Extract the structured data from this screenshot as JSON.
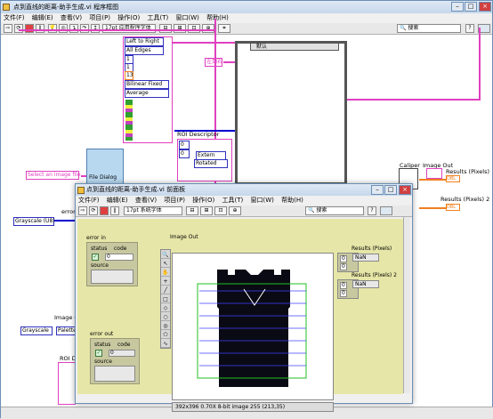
{
  "block_diagram": {
    "title": "点到直线的距离-助手生成.vi 程序框图",
    "menu": [
      "文件(F)",
      "编辑(E)",
      "查看(V)",
      "项目(P)",
      "操作(O)",
      "工具(T)",
      "窗口(W)",
      "帮助(H)"
    ],
    "font_selector": "17pt 应用程序字体",
    "search_placeholder": "搜索",
    "direction_value": "Left to Right",
    "edge_value": "All Edges",
    "num_values": [
      "1",
      "1",
      "13"
    ],
    "interp_value": "Bilinear Fixed",
    "avg_value": "Average",
    "case_label": "默认",
    "left_to_right_const": "左到右",
    "roi_descriptor_label": "ROI Descriptor",
    "roi_values": [
      "0",
      "0"
    ],
    "extern_value": "Extern",
    "rotated_value": "Rotated",
    "file_dialog_label": "File Dialog",
    "select_image_prompt": "Select an image file...",
    "grayscale_u8": "Grayscale (U8)",
    "error_label": "error",
    "image_label": "Image O",
    "grayscale": "Grayscale",
    "palette": "Palette",
    "roi_label": "ROI D",
    "caliper_label": "Caliper",
    "image_out_label": "Image Out",
    "results_label": "Results (Pixels)",
    "results2_label": "Results (Pixels) 2",
    "dbl_tag": "DBL"
  },
  "front_panel": {
    "title": "点到直线的距离-助手生成.vi 前面板",
    "menu": [
      "文件(F)",
      "编辑(E)",
      "查看(V)",
      "项目(P)",
      "操作(O)",
      "工具(T)",
      "窗口(W)",
      "帮助(H)"
    ],
    "font_selector": "17pt 系统字体",
    "search_placeholder": "搜索",
    "error_in": {
      "label": "error in",
      "status_label": "status",
      "code_label": "code",
      "code_value": "0",
      "source_label": "source"
    },
    "error_out": {
      "label": "error out",
      "status_label": "status",
      "code_label": "code",
      "code_value": "0",
      "source_label": "source"
    },
    "image_out_label": "Image Out",
    "image_status": "392x396 0.70X 8-bit image 255    (213,35)",
    "results1": {
      "label": "Results (Pixels)",
      "index": "0",
      "value": "NaN"
    },
    "results2": {
      "label": "Results (Pixels) 2",
      "index": "0",
      "value": "NaN"
    },
    "tool_icons": [
      "zoom-icon",
      "pointer-icon",
      "pan-icon",
      "point-icon",
      "line-icon",
      "rect-icon",
      "rotated-rect-icon",
      "oval-icon",
      "annulus-icon",
      "polygon-icon",
      "freehand-icon",
      "polyline-icon",
      "broken-line-icon"
    ]
  },
  "colors": {
    "wire_pink": "#e040c0",
    "wire_blue": "#0000d0",
    "wire_orange": "#f08020",
    "panel_bg": "#e6e6a8",
    "cluster_bg": "#c8c8a0"
  }
}
